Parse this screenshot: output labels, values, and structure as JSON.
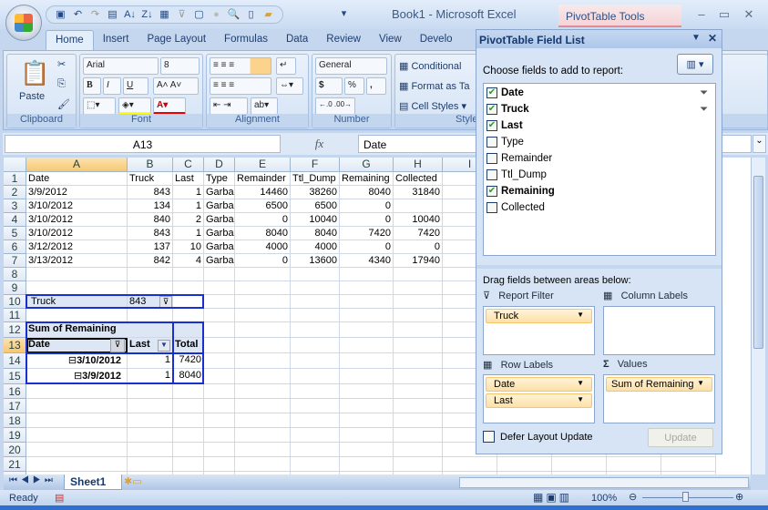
{
  "window": {
    "title": "Book1 - Microsoft Excel",
    "context_tab": "PivotTable Tools"
  },
  "ribbon": {
    "tabs": [
      "Home",
      "Insert",
      "Page Layout",
      "Formulas",
      "Data",
      "Review",
      "View",
      "Develo"
    ],
    "active_tab": "Home",
    "clipboard": {
      "label": "Clipboard",
      "paste": "Paste"
    },
    "font": {
      "label": "Font",
      "name": "Arial",
      "size": "8",
      "bold": "B",
      "italic": "I",
      "underline": "U"
    },
    "alignment": {
      "label": "Alignment"
    },
    "number": {
      "label": "Number",
      "format": "General",
      "currency": "$",
      "percent": "%",
      "comma": ","
    },
    "styles": {
      "label": "Styles",
      "conditional": "Conditional",
      "format_as_table": "Format as Ta",
      "cell_styles": "Cell Styles"
    }
  },
  "formula_bar": {
    "name_box": "A13",
    "fx": "fx",
    "value": "Date"
  },
  "grid": {
    "columns": [
      "A",
      "B",
      "C",
      "D",
      "E",
      "F",
      "G",
      "H",
      "I"
    ],
    "selected_column": "A",
    "selected_row": 13,
    "rows": [
      [
        "Date",
        "Truck",
        "Last",
        "Type",
        "Remainder",
        "Ttl_Dump",
        "Remaining",
        "Collected"
      ],
      [
        "3/9/2012",
        "843",
        "1",
        "Garba",
        "14460",
        "38260",
        "8040",
        "31840"
      ],
      [
        "3/10/2012",
        "134",
        "1",
        "Garba",
        "6500",
        "6500",
        "0",
        ""
      ],
      [
        "3/10/2012",
        "840",
        "2",
        "Garba",
        "0",
        "10040",
        "0",
        "10040"
      ],
      [
        "3/10/2012",
        "843",
        "1",
        "Garba",
        "8040",
        "8040",
        "7420",
        "7420"
      ],
      [
        "3/12/2012",
        "137",
        "10",
        "Garba",
        "4000",
        "4000",
        "0",
        "0"
      ],
      [
        "3/13/2012",
        "842",
        "4",
        "Garba",
        "0",
        "13600",
        "4340",
        "17940"
      ]
    ],
    "row_count": 21
  },
  "pivot": {
    "filter_label": "Truck",
    "filter_value": "843",
    "values_header": "Sum of  Remaining",
    "row_header": "Date",
    "col2_header": "Last",
    "total_header": "Total",
    "rows": [
      {
        "date": "3/10/2012",
        "last": "1",
        "total": "7420"
      },
      {
        "date": "3/9/2012",
        "last": "1",
        "total": "8040"
      }
    ]
  },
  "sheets": {
    "tabs": [
      "Sheet1"
    ],
    "active": "Sheet1"
  },
  "status": {
    "text": "Ready",
    "zoom": "100%"
  },
  "field_list": {
    "title": "PivotTable Field List",
    "choose_label": "Choose fields to add to report:",
    "fields": [
      {
        "name": "Date",
        "checked": true,
        "filtered": true
      },
      {
        "name": "Truck",
        "checked": true,
        "filtered": true
      },
      {
        "name": "Last",
        "checked": true,
        "filtered": false
      },
      {
        "name": "Type",
        "checked": false,
        "filtered": false
      },
      {
        "name": "Remainder",
        "checked": false,
        "filtered": false
      },
      {
        "name": "Ttl_Dump",
        "checked": false,
        "filtered": false
      },
      {
        "name": "Remaining",
        "checked": true,
        "filtered": false
      },
      {
        "name": "Collected",
        "checked": false,
        "filtered": false
      }
    ],
    "drag_label": "Drag fields between areas below:",
    "areas": {
      "report_filter": {
        "label": "Report Filter",
        "items": [
          "Truck"
        ]
      },
      "column_labels": {
        "label": "Column Labels",
        "items": []
      },
      "row_labels": {
        "label": "Row Labels",
        "items": [
          "Date",
          "Last"
        ]
      },
      "values": {
        "label": "Values",
        "items": [
          "Sum of  Remaining"
        ]
      }
    },
    "defer_label": "Defer Layout Update",
    "defer_checked": false,
    "update_label": "Update"
  }
}
